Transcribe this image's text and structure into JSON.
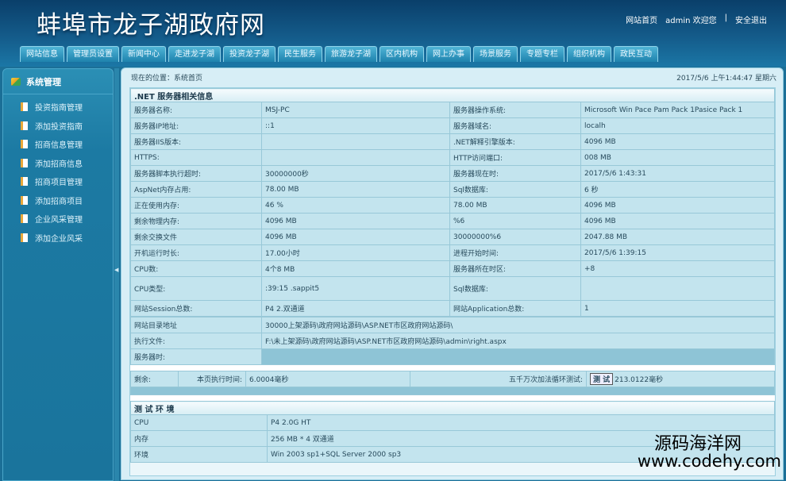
{
  "header": {
    "title": "蚌埠市龙子湖政府网",
    "links": [
      "网站首页",
      "admin 欢迎您",
      "|",
      "安全退出"
    ]
  },
  "nav": [
    "网站信息",
    "管理员设置",
    "新闻中心",
    "走进龙子湖",
    "投资龙子湖",
    "民生服务",
    "旅游龙子湖",
    "区内机构",
    "网上办事",
    "场景服务",
    "专题专栏",
    "组织机构",
    "政民互动"
  ],
  "sidebar": {
    "title": "系统管理",
    "items": [
      "投资指南管理",
      "添加投资指南",
      "招商信息管理",
      "添加招商信息",
      "招商项目管理",
      "添加招商项目",
      "企业风采管理",
      "添加企业风采"
    ]
  },
  "location": {
    "text": "现在的位置：系统首页",
    "datetime": "2017/5/6 上午1:44:47 星期六"
  },
  "server": {
    "title": ".NET 服务器相关信息",
    "rows": [
      [
        "服务器名称:",
        "MSJ-PC",
        "服务器操作系统:",
        "Microsoft Win Pace Pam Pack 1Pasice Pack 1"
      ],
      [
        "服务器IP地址:",
        "::1",
        "服务器域名:",
        "localh"
      ],
      [
        "服务器IIS版本:",
        "",
        ".NET解释引擎版本:",
        "4096 MB"
      ],
      [
        "HTTPS:",
        "",
        "HTTP访问端口:",
        "008 MB"
      ],
      [
        "服务器脚本执行超时:",
        "30000000秒",
        "服务器现在时:",
        "2017/5/6 1:43:31"
      ],
      [
        "AspNet内存占用:",
        "78.00 MB",
        "Sql数据库:",
        "6 秒"
      ],
      [
        "正在使用内存:",
        "46 %",
        "78.00 MB",
        "4096 MB"
      ],
      [
        "剩余物理内存:",
        "4096 MB",
        "%6",
        "4096 MB"
      ],
      [
        "剩余交换文件",
        "4096 MB",
        "30000000%6",
        "2047.88 MB"
      ],
      [
        "开机运行时长:",
        "17.00小时",
        "进程开始时间:",
        "2017/5/6 1:39:15"
      ],
      [
        "CPU数:",
        "4个8 MB",
        "服务器所在时区:",
        "+8"
      ],
      [
        "CPU类型:",
        ":39:15        .sappit5",
        "Sql数据库:",
        ""
      ],
      [
        "网站Session总数:",
        "P4 2.双通道",
        "网站Application总数:",
        "1"
      ]
    ],
    "wide_rows": [
      [
        "网站目录地址",
        "30000上架源码\\政府网站源码\\ASP.NET市区政府网站源码\\"
      ],
      [
        "执行文件:",
        "F:\\未上架源码\\政府网站源码\\ASP.NET市区政府网站源码\\admin\\right.aspx"
      ]
    ],
    "server_time_label": "服务器时:",
    "remain_label": "剩余:",
    "exec_label": "本页执行时间:",
    "exec_value": "6.0004毫秒",
    "loop_label": "五千万次加法循环测试:",
    "test_button": "测 试",
    "loop_value": "213.0122毫秒"
  },
  "env": {
    "title": "测 试 环 境",
    "rows": [
      [
        "CPU",
        "P4 2.0G HT"
      ],
      [
        "内存",
        "256 MB * 4 双通道"
      ],
      [
        "环境",
        "Win 2003 sp1+SQL Server 2000 sp3"
      ]
    ]
  },
  "watermark": {
    "name": "源码海洋网",
    "url": "www.codehy.com"
  }
}
